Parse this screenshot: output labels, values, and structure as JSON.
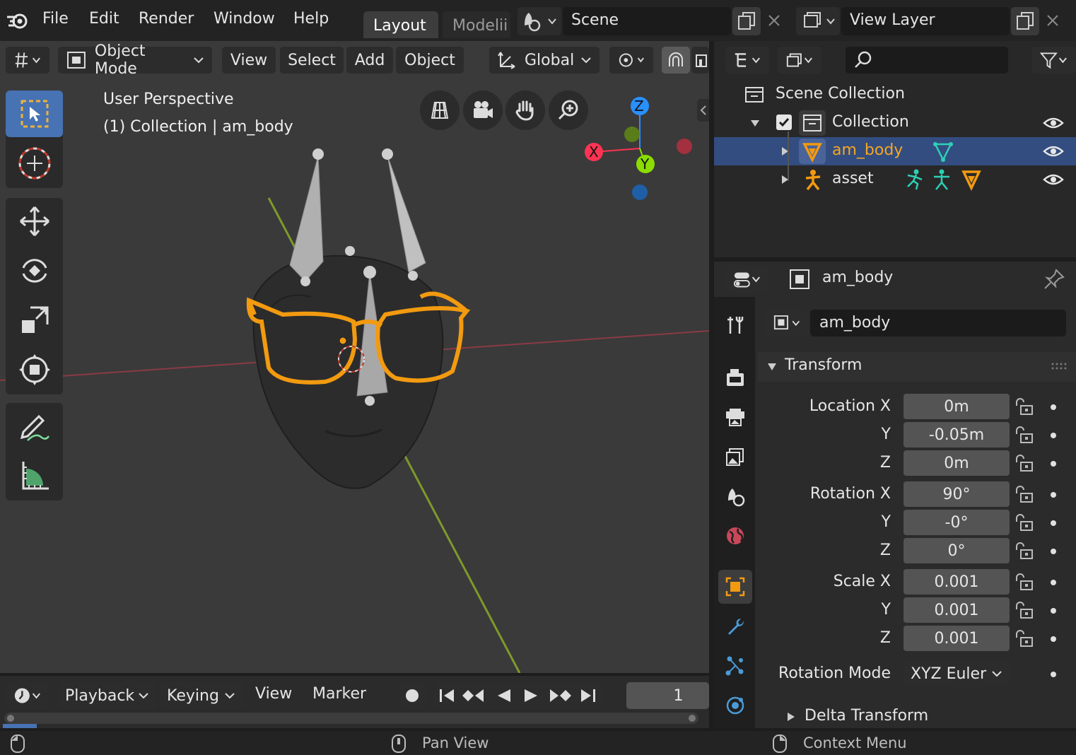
{
  "topbar": {
    "menus": [
      "File",
      "Edit",
      "Render",
      "Window",
      "Help"
    ],
    "workspace_tabs": [
      "Layout",
      "Modelii"
    ],
    "scene_name": "Scene",
    "view_layer_name": "View Layer"
  },
  "viewport_header": {
    "mode": "Object Mode",
    "menus": [
      "View",
      "Select",
      "Add",
      "Object"
    ],
    "transform_orientation": "Global"
  },
  "viewport": {
    "perspective_label": "User Perspective",
    "context_label": "(1) Collection | am_body",
    "gizmo_axes": [
      "X",
      "Y",
      "Z"
    ]
  },
  "timeline": {
    "menus": [
      "Playback",
      "Keying",
      "View",
      "Marker"
    ],
    "current_frame": "1"
  },
  "statusbar": {
    "middle": "Pan View",
    "right": "Context Menu"
  },
  "outliner": {
    "root": "Scene Collection",
    "collection": "Collection",
    "items": [
      "am_body",
      "asset"
    ]
  },
  "properties": {
    "object_name": "am_body",
    "datablock_name": "am_body",
    "panel_transform": "Transform",
    "panel_delta": "Delta Transform",
    "rows": [
      {
        "label": "Location X",
        "value": "0m"
      },
      {
        "label": "Y",
        "value": "-0.05m"
      },
      {
        "label": "Z",
        "value": "0m"
      },
      {
        "label": "Rotation X",
        "value": "90°"
      },
      {
        "label": "Y",
        "value": "-0°"
      },
      {
        "label": "Z",
        "value": "0°"
      },
      {
        "label": "Scale X",
        "value": "0.001"
      },
      {
        "label": "Y",
        "value": "0.001"
      },
      {
        "label": "Z",
        "value": "0.001"
      }
    ],
    "rotation_mode_label": "Rotation Mode",
    "rotation_mode_value": "XYZ Euler"
  },
  "colors": {
    "accent_selection": "#334d80",
    "active_orange": "#f5a623",
    "axis_x": "#ff3352",
    "axis_y": "#8bdc00",
    "axis_z": "#2890ff"
  }
}
